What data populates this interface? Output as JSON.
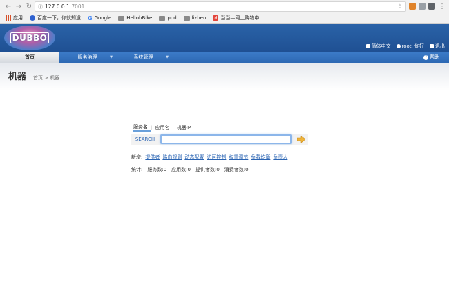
{
  "browser": {
    "url_host": "127.0.0.1",
    "url_port": ":7001",
    "bookmarks": [
      {
        "label": "应用",
        "icon": "apps-grid-icon"
      },
      {
        "label": "百度一下，你就知道",
        "icon": "baidu-paw-icon"
      },
      {
        "label": "Google",
        "icon": "google-g-icon"
      },
      {
        "label": "HellobBike",
        "icon": "folder-icon"
      },
      {
        "label": "ppd",
        "icon": "folder-icon"
      },
      {
        "label": "lizhen",
        "icon": "folder-icon"
      },
      {
        "label": "当当—网上购物中...",
        "icon": "dangdang-icon"
      }
    ]
  },
  "header": {
    "logo_text": "DUBBO",
    "lang_link": "简体中文",
    "user_link": "root, 你好",
    "logout_link": "退出"
  },
  "menu": {
    "items": [
      "首页",
      "服务治理",
      "系统管理"
    ],
    "help": "帮助"
  },
  "page": {
    "title": "机器",
    "breadcrumb": "首页 > 机器"
  },
  "search": {
    "tabs": [
      "服务名",
      "应用名",
      "机器IP"
    ],
    "label": "SEARCH",
    "value": ""
  },
  "add_links": {
    "label": "新增:",
    "items": [
      "提供者",
      "路由规则",
      "动态配置",
      "访问控制",
      "权重调节",
      "负载均衡",
      "负责人"
    ]
  },
  "stats": {
    "label": "统计:",
    "items": [
      "服务数:0",
      "应用数:0",
      "提供者数:0",
      "消费者数:0"
    ]
  },
  "colors": {
    "header_blue": "#1f5093",
    "menu_blue": "#2d68b3",
    "link_blue": "#2a64b3"
  }
}
